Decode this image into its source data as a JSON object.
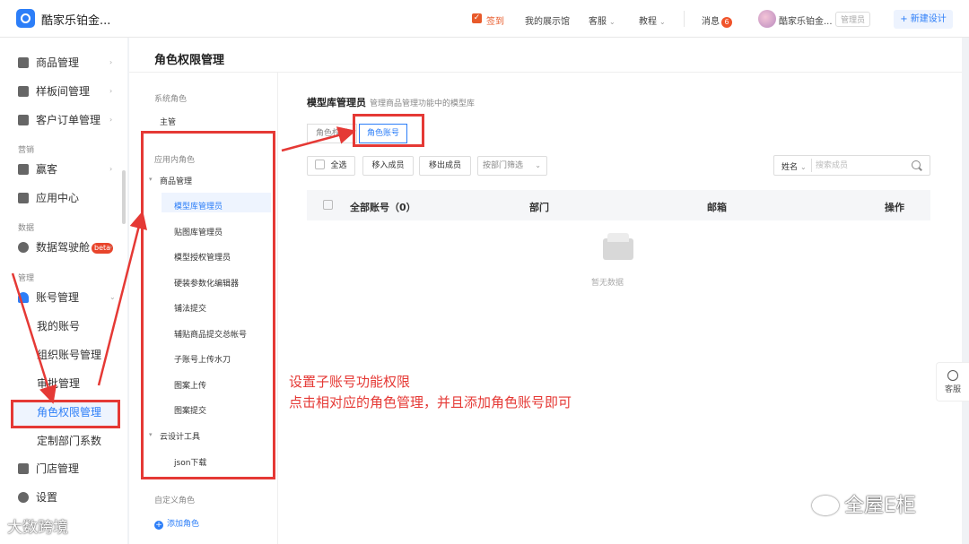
{
  "app": {
    "title": "酷家乐铂金..."
  },
  "topbar": {
    "checkin": "签到",
    "showroom": "我的展示馆",
    "service": "客服",
    "tutorial": "教程",
    "messages": "消息",
    "message_count": "6",
    "user_name": "酷家乐铂金...",
    "role_tag": "管理员",
    "new_design": "+ 新建设计"
  },
  "sidebar": {
    "items": [
      {
        "label": "商品管理",
        "icon": "product-icon"
      },
      {
        "label": "样板间管理",
        "icon": "showroom-icon"
      },
      {
        "label": "客户订单管理",
        "icon": "order-icon"
      }
    ],
    "group_marketing": "营销",
    "marketing_items": [
      {
        "label": "赢客",
        "icon": "handshake-icon"
      },
      {
        "label": "应用中心",
        "icon": "apps-icon"
      }
    ],
    "group_data": "数据",
    "data_item": "数据驾驶舱",
    "data_badge": "beta",
    "group_manage": "管理",
    "account_manage": "账号管理",
    "account_subs": [
      "我的账号",
      "组织账号管理",
      "审批管理",
      "角色权限管理",
      "定制部门系数"
    ],
    "store_manage": "门店管理",
    "settings": "设置"
  },
  "page": {
    "title": "角色权限管理"
  },
  "role_panel": {
    "system_group": "系统角色",
    "system_roles": [
      "主管"
    ],
    "app_group": "应用内角色",
    "category_product": "商品管理",
    "product_roles": [
      "模型库管理员",
      "贴图库管理员",
      "模型授权管理员",
      "硬装参数化编辑器",
      "铺法提交",
      "辅贴商品提交总帐号",
      "子账号上传水刀",
      "图案上传",
      "图案提交"
    ],
    "category_cloud": "云设计工具",
    "cloud_roles": [
      "json下载"
    ],
    "custom_group": "自定义角色",
    "add_role": "添加角色"
  },
  "main": {
    "role_title": "模型库管理员",
    "role_desc": "管理商品管理功能中的模型库",
    "tabs": [
      "角色权限",
      "角色账号"
    ],
    "active_tab": "角色账号",
    "select_all": "全选",
    "add_member": "移入成员",
    "remove_member": "移出成员",
    "dept_filter": "按部门筛选",
    "search_type": "姓名",
    "search_placeholder": "搜索成员",
    "columns": [
      "全部账号（0）",
      "部门",
      "邮箱",
      "操作"
    ],
    "empty_text": "暂无数据"
  },
  "annotation": {
    "line1": "设置子账号功能权限",
    "line2": "点击相对应的角色管理，并且添加角色账号即可"
  },
  "float_service": "客服",
  "watermarks": {
    "left": "大数跨境",
    "right": "全屋E柜"
  },
  "colors": {
    "accent": "#2c7ef8",
    "annotation": "#e53935",
    "badge": "#f0532a"
  }
}
